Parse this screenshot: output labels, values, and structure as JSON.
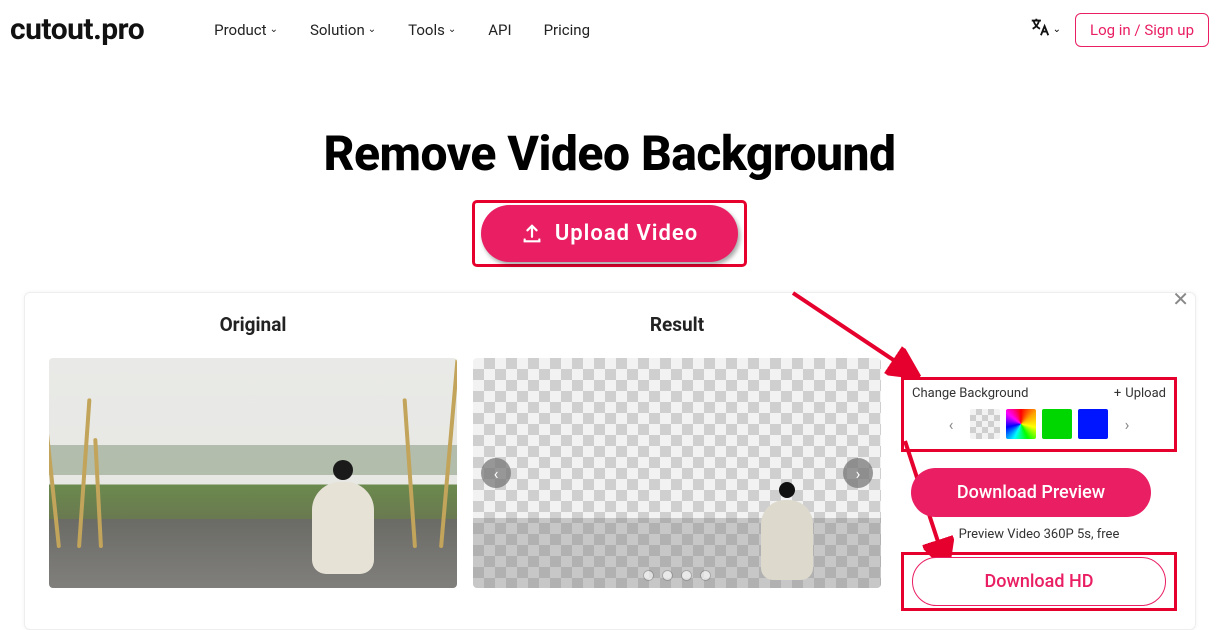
{
  "header": {
    "logo": "cutout.pro",
    "nav": {
      "product": "Product",
      "solution": "Solution",
      "tools": "Tools",
      "api": "API",
      "pricing": "Pricing"
    },
    "login": "Log in / Sign up"
  },
  "hero": {
    "title": "Remove Video Background",
    "upload": "Upload Video"
  },
  "editor": {
    "original": "Original",
    "result": "Result",
    "change_bg": "Change Background",
    "upload_bg": "Upload",
    "download_preview": "Download Preview",
    "preview_note": "Preview Video 360P 5s, free",
    "download_hd": "Download HD"
  }
}
